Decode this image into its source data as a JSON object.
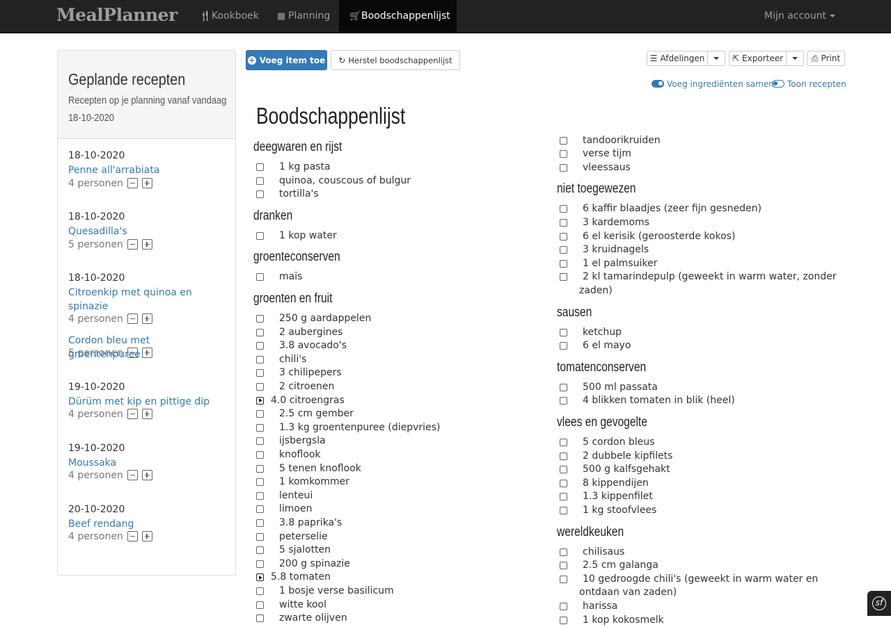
{
  "brand": "MealPlanner",
  "nav": {
    "items": [
      {
        "label": "Kookboek",
        "icon": "cutlery-icon"
      },
      {
        "label": "Planning",
        "icon": "calendar-icon"
      },
      {
        "label": "Boodschappenlijst",
        "icon": "shopping-cart-icon",
        "active": true
      }
    ],
    "account": "Mijn account"
  },
  "sidebar": {
    "title": "Geplande recepten",
    "subtitle": "Recepten op je planning vanaf vandaag",
    "date": "18-10-2020",
    "groups": [
      {
        "date": "18-10-2020",
        "recipe": "Penne all'arrabiata",
        "persons": "4 personen"
      },
      {
        "date": "18-10-2020",
        "recipe": "Quesadilla's",
        "persons": "5 personen"
      },
      {
        "date": "18-10-2020",
        "recipe": "Citroenkip met quinoa en spinazie",
        "persons": "4 personen"
      },
      {
        "date": "",
        "recipe": "Cordon bleu met groentenpuree",
        "persons": "5 personen"
      },
      {
        "date": "19-10-2020",
        "recipe": "Dürüm met kip en pittige dip",
        "persons": "4 personen"
      },
      {
        "date": "19-10-2020",
        "recipe": "Moussaka",
        "persons": "4 personen"
      },
      {
        "date": "20-10-2020",
        "recipe": "Beef rendang",
        "persons": "4 personen"
      }
    ]
  },
  "toolbar": {
    "add_item": "Voeg item toe",
    "reset": "Herstel boodschappenlijst",
    "departments": "Afdelingen",
    "export": "Exporteer",
    "print": "Print",
    "merge_toggle": "Voeg ingrediënten samen",
    "recipes_toggle": "Toon recepten"
  },
  "list": {
    "title": "Boodschappenlijst",
    "left": [
      {
        "category": "deegwaren en rijst",
        "items": [
          "1 kg pasta",
          "quinoa, couscous of bulgur",
          "tortilla's"
        ]
      },
      {
        "category": "dranken",
        "items": [
          "1 kop water"
        ]
      },
      {
        "category": "groenteconserven",
        "items": [
          "maïs"
        ]
      },
      {
        "category": "groenten en fruit",
        "items": [
          "250 g aardappelen",
          "2 aubergines",
          "3.8 avocado's",
          "chili's",
          "3 chilipepers",
          "2 citroenen",
          "4.0 citroengras",
          "2.5 cm gember",
          "1.3 kg groentenpuree (diepvries)",
          "ijsbergsla",
          "knoflook",
          "5 tenen knoflook",
          "1 komkommer",
          "lenteui",
          "limoen",
          "3.8 paprika's",
          "peterselie",
          "5 sjalotten",
          "200 g spinazie",
          "5.8 tomaten",
          "1 bosje verse basilicum",
          "witte kool",
          "zwarte olijven"
        ]
      }
    ],
    "right": [
      {
        "category": "",
        "items": [
          "tandoorikruiden",
          "verse tijm",
          "vleessaus"
        ]
      },
      {
        "category": "niet toegewezen",
        "items": [
          "6 kaffir blaadjes (zeer fijn gesneden)",
          "3 kardemoms",
          "6 el kerisik (geroosterde kokos)",
          "3 kruidnagels",
          "1 el palmsuiker",
          "2 kl tamarindepulp (geweekt in warm water, zonder",
          "zaden)"
        ]
      },
      {
        "category": "sausen",
        "items": [
          "ketchup",
          "6 el mayo"
        ]
      },
      {
        "category": "tomatenconserven",
        "items": [
          "500 ml passata",
          "4 blikken tomaten in blik (heel)"
        ]
      },
      {
        "category": "vlees en gevogelte",
        "items": [
          "5 cordon bleus",
          "2 dubbele kipfilets",
          "500 g kalfsgehakt",
          "8 kippendijen",
          "1.3 kippenfilet",
          "1 kg stoofvlees"
        ]
      },
      {
        "category": "wereldkeuken",
        "items": [
          "chilisaus",
          "2.5 cm galanga",
          "10 gedroogde chili's (geweekt in warm water en",
          "ontdaan van zaden)",
          "harissa",
          "1 kop kokosmelk"
        ]
      }
    ]
  }
}
